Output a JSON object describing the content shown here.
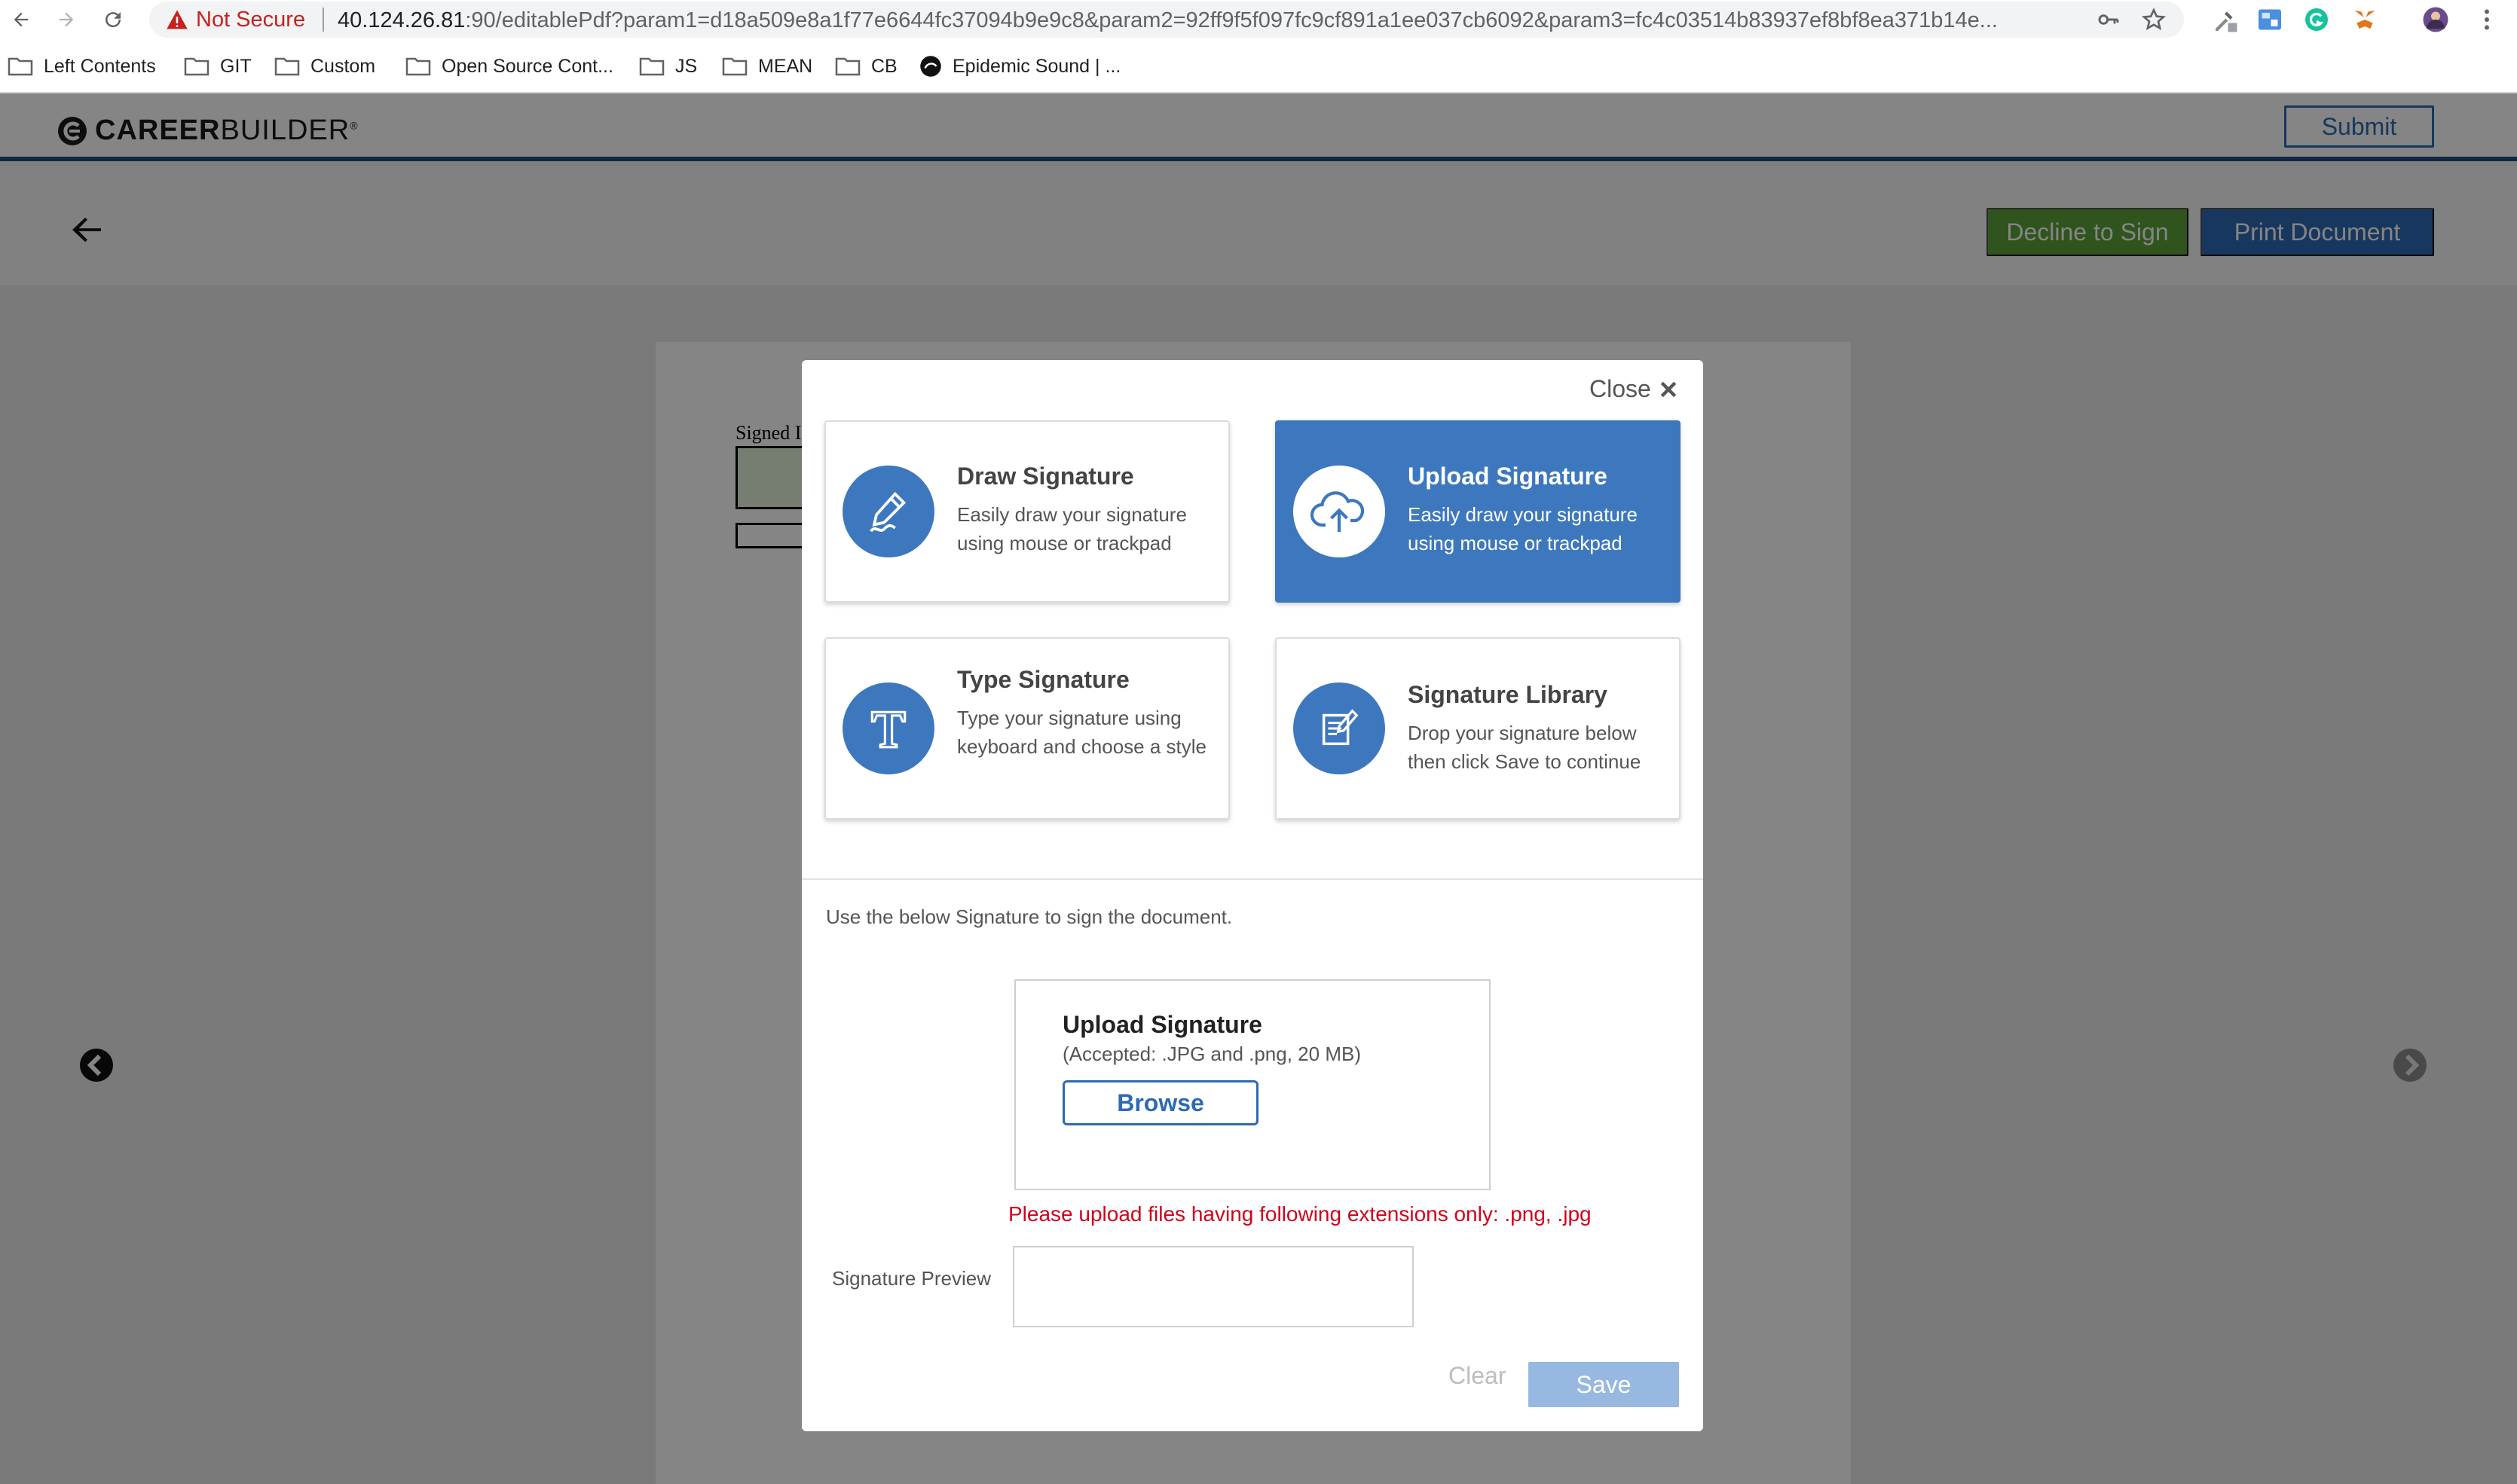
{
  "browser": {
    "security_label": "Not Secure",
    "url_host": "40.124.26.81",
    "url_path": ":90/editablePdf?param1=d18a509e8a1f77e6644fc37094b9e9c8&param2=92ff9f5f097fc9cf891a1ee037cb6092&param3=fc4c03514b83937ef8bf8ea371b14e...",
    "bookmarks": [
      "Left Contents",
      "GIT",
      "Custom",
      "Open Source Cont...",
      "JS",
      "MEAN",
      "CB",
      "Epidemic Sound | ..."
    ]
  },
  "app": {
    "logo_career": "CAREER",
    "logo_builder": "BUILDER",
    "logo_reg": "®",
    "submit_label": "Submit",
    "decline_label": "Decline to Sign",
    "print_label": "Print Document",
    "document": {
      "signed_label": "Signed I"
    }
  },
  "modal": {
    "close_label": "Close",
    "cards": [
      {
        "title": "Draw Signature",
        "desc": "Easily draw your signature using mouse or trackpad",
        "icon": "pen-icon",
        "active": false
      },
      {
        "title": "Upload Signature",
        "desc": "Easily draw your signature using mouse or trackpad",
        "icon": "cloud-upload-icon",
        "active": true
      },
      {
        "title": "Type Signature",
        "desc": "Type your signature using keyboard and choose a style",
        "icon": "type-t-icon",
        "active": false
      },
      {
        "title": "Signature Library",
        "desc": "Drop your signature below then click Save to continue",
        "icon": "library-icon",
        "active": false
      }
    ],
    "instruction": "Use the below Signature to sign the document.",
    "upload": {
      "title": "Upload Signature",
      "accepted": "(Accepted: .JPG and .png, 20 MB)",
      "browse_label": "Browse"
    },
    "error_message": "Please upload files having following extensions only: .png, .jpg",
    "preview_label": "Signature Preview",
    "clear_label": "Clear",
    "save_label": "Save"
  },
  "colors": {
    "brand_blue": "#2e6ab4",
    "card_active": "#3d78bf",
    "decline_green": "#5aa13a",
    "error_red": "#d0021b"
  }
}
